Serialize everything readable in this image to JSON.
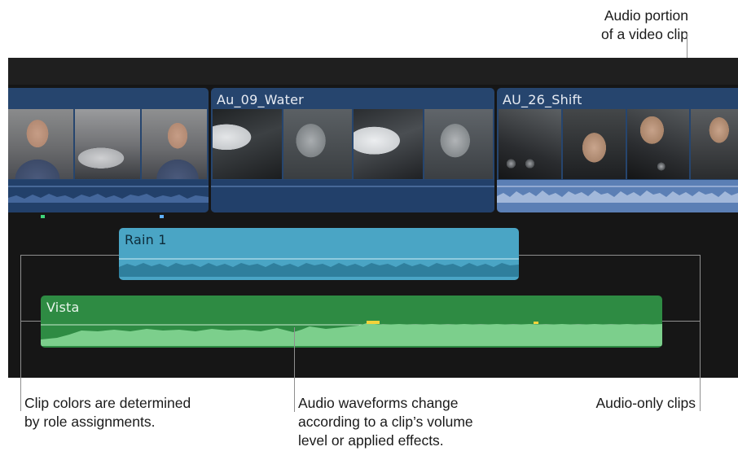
{
  "callouts": {
    "audio_portion": "Audio portion\nof a video clip",
    "clip_colors": "Clip colors are determined\nby role assignments.",
    "waveforms": "Audio waveforms change\naccording to a clip’s volume\nlevel or applied effects.",
    "audio_only": "Audio-only clips"
  },
  "clips": {
    "video_1": {
      "name": ""
    },
    "video_2": {
      "name": "Au_09_Water"
    },
    "video_3": {
      "name": "AU_26_Shift"
    },
    "audio_1": {
      "name": "Rain 1"
    },
    "audio_2": {
      "name": "Vista"
    }
  },
  "colors": {
    "timeline_bg": "#161616",
    "video_clip": "#26456e",
    "video_audio_selected": "#5b7fb5",
    "dialogue_role": "#4cb7d8",
    "effects_role": "#2e8b43",
    "music_role": "#4aa5c5",
    "marker_green": "#3fd47a",
    "marker_blue": "#5fb0ff",
    "peak_yellow": "#f3d23a"
  }
}
